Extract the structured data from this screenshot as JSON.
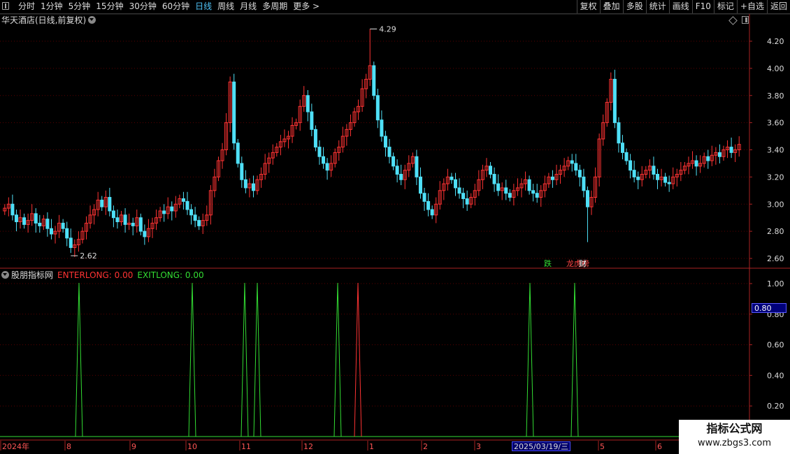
{
  "toolbar": {
    "periods": [
      "分时",
      "1分钟",
      "5分钟",
      "15分钟",
      "30分钟",
      "60分钟",
      "日线",
      "周线",
      "月线",
      "多周期",
      "更多 >"
    ],
    "active_period": "日线",
    "tools": [
      "复权",
      "叠加",
      "多股",
      "统计",
      "画线",
      "F10",
      "标记",
      "+自选",
      "返回"
    ]
  },
  "main_chart": {
    "title": "华天酒店(日线,前复权)",
    "high_label": "4.29",
    "low_label": "2.62",
    "y_ticks": [
      "4.20",
      "4.00",
      "3.80",
      "3.60",
      "3.40",
      "3.20",
      "3.00",
      "2.80",
      "2.60"
    ],
    "event_labels": [
      {
        "text": "跌",
        "color": "#33dd33"
      },
      {
        "text": "龙虎榜",
        "color": "#ff4444"
      },
      {
        "text": "财",
        "color": "#ffffff"
      }
    ]
  },
  "indicator": {
    "name": "股朋指标网",
    "enter": "ENTERLONG: 0.00",
    "exit": "EXITLONG: 0.00",
    "y_ticks": [
      "1.00",
      "0.80",
      "0.60",
      "0.40",
      "0.20"
    ],
    "current_value": "0.80"
  },
  "x_axis": {
    "labels": [
      "2024年",
      "8",
      "9",
      "10",
      "11",
      "12",
      "1",
      "2",
      "3",
      "5",
      "6"
    ],
    "highlight_date": "2025/03/19/三"
  },
  "watermark": {
    "title": "指标公式网",
    "url": "www.zbgs3.com"
  },
  "colors": {
    "up": "#ff3333",
    "down": "#4fe0f7",
    "grid": "#550000",
    "enter": "#ff3333",
    "exit": "#33dd33",
    "active_tab": "#4fc3f7"
  },
  "chart_data": {
    "type": "candlestick",
    "title": "华天酒店(日线,前复权)",
    "ylim": [
      2.55,
      4.35
    ],
    "close_series": [
      2.97,
      3.0,
      2.92,
      2.87,
      2.9,
      2.85,
      2.88,
      2.93,
      2.86,
      2.84,
      2.89,
      2.82,
      2.78,
      2.8,
      2.86,
      2.82,
      2.75,
      2.68,
      2.7,
      2.74,
      2.8,
      2.86,
      2.92,
      2.96,
      3.03,
      2.98,
      3.05,
      2.95,
      2.9,
      2.87,
      2.92,
      2.85,
      2.86,
      2.84,
      2.9,
      2.8,
      2.76,
      2.82,
      2.86,
      2.9,
      2.95,
      2.93,
      2.98,
      2.95,
      3.0,
      3.04,
      3.02,
      2.96,
      2.92,
      2.88,
      2.84,
      2.88,
      2.92,
      3.1,
      3.2,
      3.32,
      3.4,
      3.6,
      3.9,
      3.45,
      3.3,
      3.18,
      3.12,
      3.15,
      3.1,
      3.18,
      3.22,
      3.3,
      3.34,
      3.38,
      3.42,
      3.46,
      3.48,
      3.5,
      3.58,
      3.6,
      3.72,
      3.8,
      3.68,
      3.55,
      3.42,
      3.35,
      3.3,
      3.25,
      3.3,
      3.38,
      3.42,
      3.5,
      3.55,
      3.6,
      3.68,
      3.72,
      3.85,
      3.92,
      4.02,
      3.8,
      3.62,
      3.5,
      3.42,
      3.35,
      3.28,
      3.22,
      3.18,
      3.25,
      3.3,
      3.35,
      3.2,
      3.08,
      3.02,
      2.96,
      2.92,
      3.0,
      3.1,
      3.15,
      3.2,
      3.18,
      3.12,
      3.08,
      3.04,
      3.0,
      3.05,
      3.1,
      3.18,
      3.25,
      3.28,
      3.22,
      3.15,
      3.1,
      3.12,
      3.08,
      3.05,
      3.1,
      3.12,
      3.15,
      3.18,
      3.1,
      3.08,
      3.05,
      3.1,
      3.15,
      3.2,
      3.18,
      3.22,
      3.25,
      3.28,
      3.32,
      3.3,
      3.25,
      3.2,
      3.1,
      2.98,
      3.05,
      3.2,
      3.48,
      3.6,
      3.75,
      3.92,
      3.6,
      3.45,
      3.38,
      3.32,
      3.25,
      3.2,
      3.18,
      3.22,
      3.25,
      3.28,
      3.22,
      3.18,
      3.2,
      3.16,
      3.15,
      3.2,
      3.22,
      3.25,
      3.28,
      3.3,
      3.32,
      3.28,
      3.3,
      3.35,
      3.32,
      3.36,
      3.38,
      3.35,
      3.4,
      3.42,
      3.38,
      3.4,
      3.44
    ],
    "enterlong_signals": [
      0.72,
      0.855,
      0.965,
      0.988,
      1.155,
      1.185,
      1.305,
      1.33,
      1.42,
      1.945,
      2.08
    ],
    "note_x_positions_are_event_indexes": "signals expressed as category positions along time axis"
  }
}
